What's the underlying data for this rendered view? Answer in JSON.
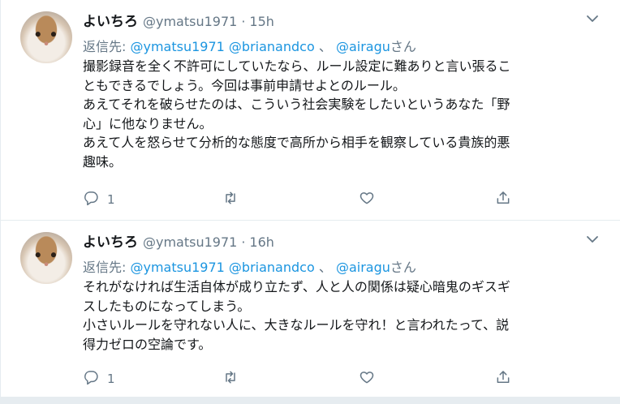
{
  "tweets": [
    {
      "display_name": "よいちろ",
      "handle": "@ymatsu1971",
      "separator": "·",
      "time": "15h",
      "reply_prefix": "返信先:",
      "reply_mention_1": "@ymatsu1971",
      "reply_mention_2": "@brianandco",
      "reply_separator": "、",
      "reply_mention_3": "@airagu",
      "reply_suffix": "さん",
      "lines": [
        "撮影録音を全く不許可にしていたなら、ルール設定に難ありと言い張るこ",
        "ともできるでしょう。今回は事前申請せよとのルール。",
        "あえてそれを破らせたのは、こういう社会実験をしたいというあなた「野",
        "心」に他なりません。",
        "あえて人を怒らせて分析的な態度で高所から相手を観察している貴族的悪",
        "趣味。"
      ],
      "reply_count": "1"
    },
    {
      "display_name": "よいちろ",
      "handle": "@ymatsu1971",
      "separator": "·",
      "time": "16h",
      "reply_prefix": "返信先:",
      "reply_mention_1": "@ymatsu1971",
      "reply_mention_2": "@brianandco",
      "reply_separator": "、",
      "reply_mention_3": "@airagu",
      "reply_suffix": "さん",
      "lines": [
        "それがなければ生活自体が成り立たず、人と人の関係は疑心暗鬼のギスギ",
        "スしたものになってしまう。",
        "小さいルールを守れない人に、大きなルールを守れ！と言われたって、説",
        "得力ゼロの空論です。"
      ],
      "reply_count": "1"
    }
  ],
  "icons": {
    "caret": "chevron-down-icon",
    "reply": "reply-bubble-icon",
    "retweet": "retweet-icon",
    "like": "heart-icon",
    "share": "share-icon"
  },
  "colors": {
    "text": "#14171a",
    "muted": "#657786",
    "link": "#1b95e0",
    "border": "#e6ecf0"
  }
}
